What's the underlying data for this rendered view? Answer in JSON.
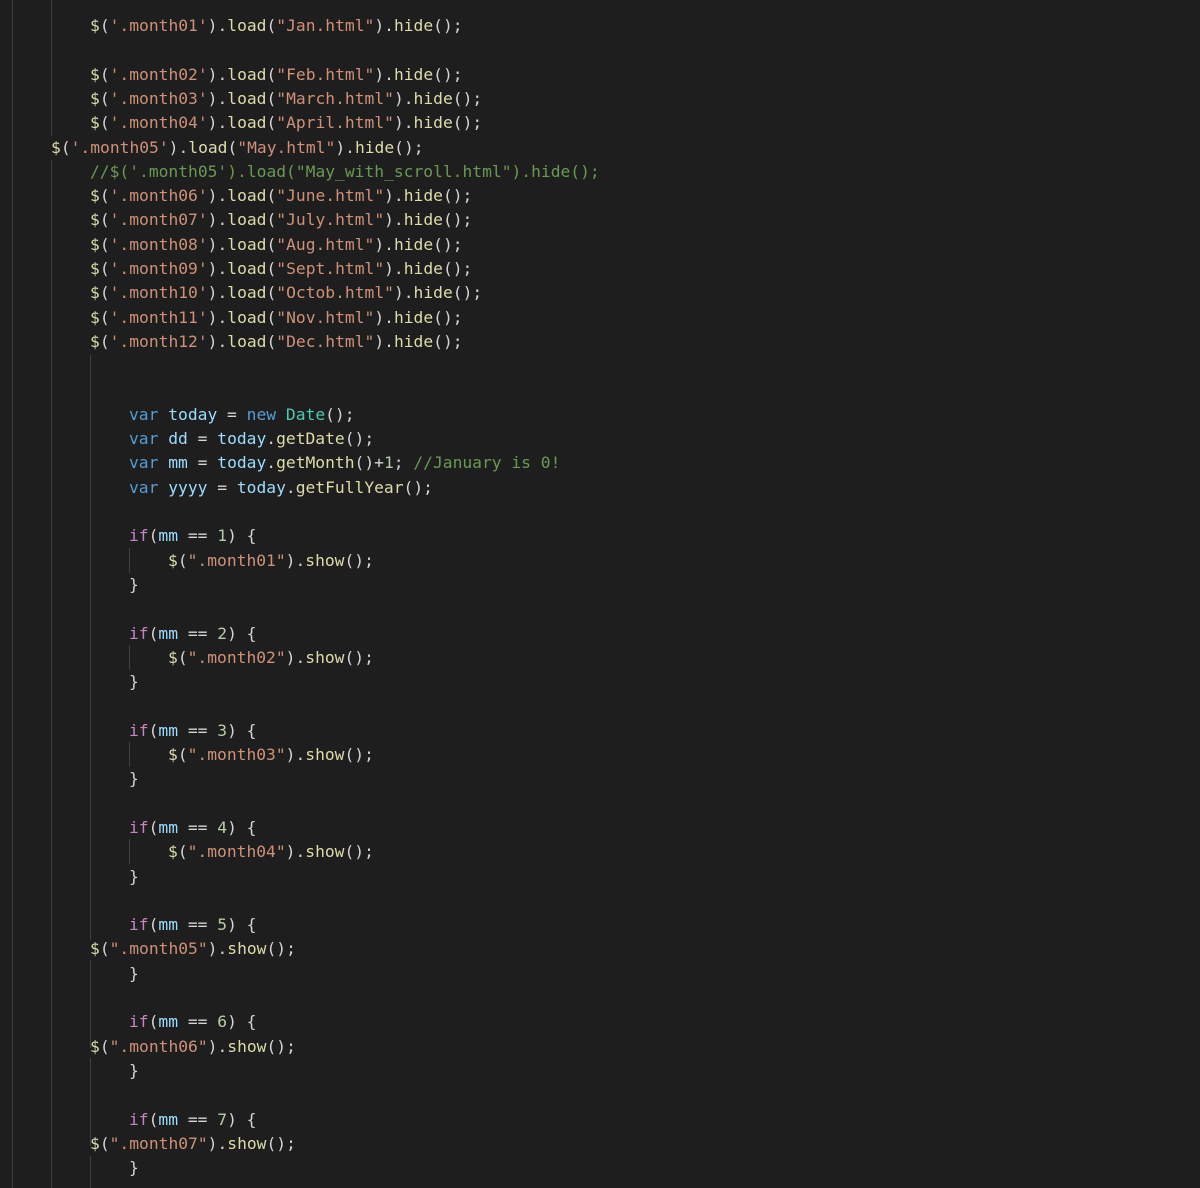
{
  "code_lines": [
    "$('.month01').load(\"Jan.html\").hide();",
    "",
    "$('.month02').load(\"Feb.html\").hide();",
    "$('.month03').load(\"March.html\").hide();",
    "$('.month04').load(\"April.html\").hide();",
    "$('.month05').load(\"May.html\").hide();",
    "//$('.month05').load(\"May_with_scroll.html\").hide();",
    "$('.month06').load(\"June.html\").hide();",
    "$('.month07').load(\"July.html\").hide();",
    "$('.month08').load(\"Aug.html\").hide();",
    "$('.month09').load(\"Sept.html\").hide();",
    "$('.month10').load(\"Octob.html\").hide();",
    "$('.month11').load(\"Nov.html\").hide();",
    "$('.month12').load(\"Dec.html\").hide();",
    "",
    "",
    "var today = new Date();",
    "var dd = today.getDate();",
    "var mm = today.getMonth()+1; //January is 0!",
    "var yyyy = today.getFullYear();",
    "",
    "if(mm == 1) {",
    "$(\".month01\").show();",
    "}",
    "",
    "if(mm == 2) {",
    "$(\".month02\").show();",
    "}",
    "",
    "if(mm == 3) {",
    "$(\".month03\").show();",
    "}",
    "",
    "if(mm == 4) {",
    "$(\".month04\").show();",
    "}",
    "",
    "if(mm == 5) {",
    "$(\".month05\").show();",
    "}",
    "",
    "if(mm == 6) {",
    "$(\".month06\").show();",
    "}",
    "",
    "if(mm == 7) {",
    "$(\".month07\").show();",
    "}"
  ]
}
